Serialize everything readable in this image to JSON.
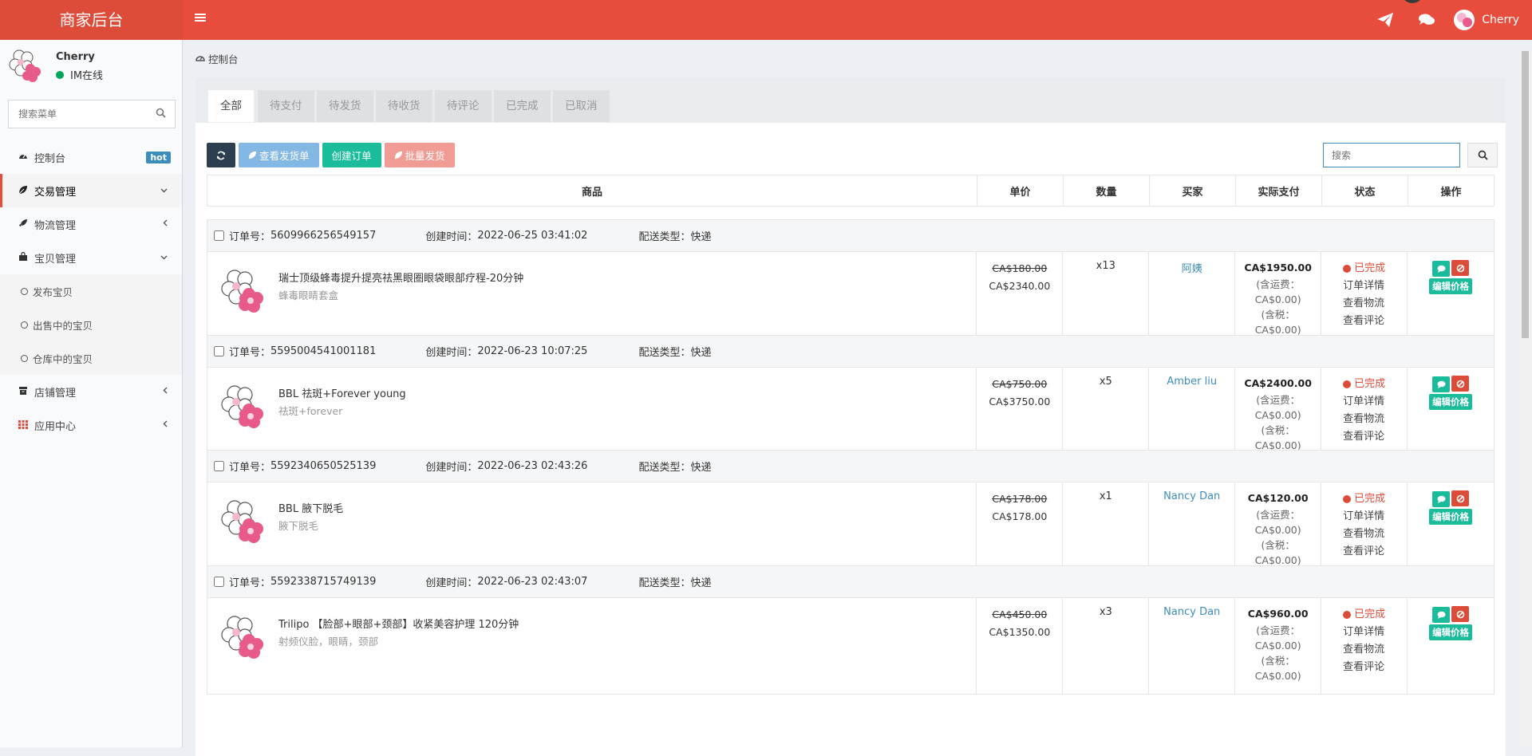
{
  "app": {
    "brand": "商家后台",
    "user": "Cherry"
  },
  "sidebar": {
    "user_name": "Cherry",
    "status": "IM在线",
    "search_placeholder": "搜索菜单",
    "items": [
      {
        "label": "控制台",
        "icon": "dashboard-icon",
        "badge": "hot"
      },
      {
        "label": "交易管理",
        "icon": "leaf-icon",
        "active": true
      },
      {
        "label": "物流管理",
        "icon": "rocket-icon"
      },
      {
        "label": "宝贝管理",
        "icon": "shopping-bag-icon"
      },
      {
        "label": "店铺管理",
        "icon": "archive-icon"
      },
      {
        "label": "应用中心",
        "icon": "apps-grid-icon"
      }
    ],
    "subitems": [
      "发布宝贝",
      "出售中的宝贝",
      "仓库中的宝贝"
    ]
  },
  "breadcrumb": "控制台",
  "tabs": [
    "全部",
    "待支付",
    "待发货",
    "待收货",
    "待评论",
    "已完成",
    "已取消"
  ],
  "toolbar": {
    "view_shipping": "查看发货单",
    "create_order": "创建订单",
    "batch_ship": "批量发货",
    "search_placeholder": "搜索"
  },
  "table": {
    "headers": [
      "商品",
      "单价",
      "数量",
      "买家",
      "实际支付",
      "状态",
      "操作"
    ]
  },
  "labels": {
    "order_no": "订单号：",
    "created": "创建时间：",
    "delivery": "配送类型：",
    "shipping_incl": "(含运费：",
    "tax_incl": "(含税：",
    "order_detail": "订单详情",
    "view_logistics": "查看物流",
    "view_review": "查看评论",
    "edit_price": "编辑价格"
  },
  "orders": [
    {
      "no": "5609966256549157",
      "time": "2022-06-25 03:41:02",
      "delivery": "快递",
      "name": "瑞士顶级蜂毒提升提亮祛黑眼圈眼袋眼部疗程-20分钟",
      "sub": "蜂毒眼睛套盒",
      "old_price": "CA$180.00",
      "price": "CA$2340.00",
      "qty": "x13",
      "buyer": "阿姨",
      "pay": "CA$1950.00",
      "ship": "CA$0.00)",
      "tax": "CA$0.00)",
      "status": "已完成"
    },
    {
      "no": "5595004541001181",
      "time": "2022-06-23 10:07:25",
      "delivery": "快递",
      "name": "BBL 祛斑+Forever young",
      "sub": "祛斑+forever",
      "old_price": "CA$750.00",
      "price": "CA$3750.00",
      "qty": "x5",
      "buyer": "Amber liu",
      "pay": "CA$2400.00",
      "ship": "CA$0.00)",
      "tax": "CA$0.00)",
      "status": "已完成"
    },
    {
      "no": "5592340650525139",
      "time": "2022-06-23 02:43:26",
      "delivery": "快递",
      "name": "BBL 腋下脱毛",
      "sub": "腋下脱毛",
      "old_price": "CA$178.00",
      "price": "CA$178.00",
      "qty": "x1",
      "buyer": "Nancy Dan",
      "pay": "CA$120.00",
      "ship": "CA$0.00)",
      "tax": "CA$0.00)",
      "status": "已完成"
    },
    {
      "no": "5592338715749139",
      "time": "2022-06-23 02:43:07",
      "delivery": "快递",
      "name": "Trilipo 【脸部+眼部+颈部】收紧美容护理 120分钟",
      "sub": "射频仪脸，眼睛，颈部",
      "old_price": "CA$450.00",
      "price": "CA$1350.00",
      "qty": "x3",
      "buyer": "Nancy Dan",
      "pay": "CA$960.00",
      "ship": "CA$0.00)",
      "tax": "CA$0.00)",
      "status": "已完成"
    }
  ]
}
